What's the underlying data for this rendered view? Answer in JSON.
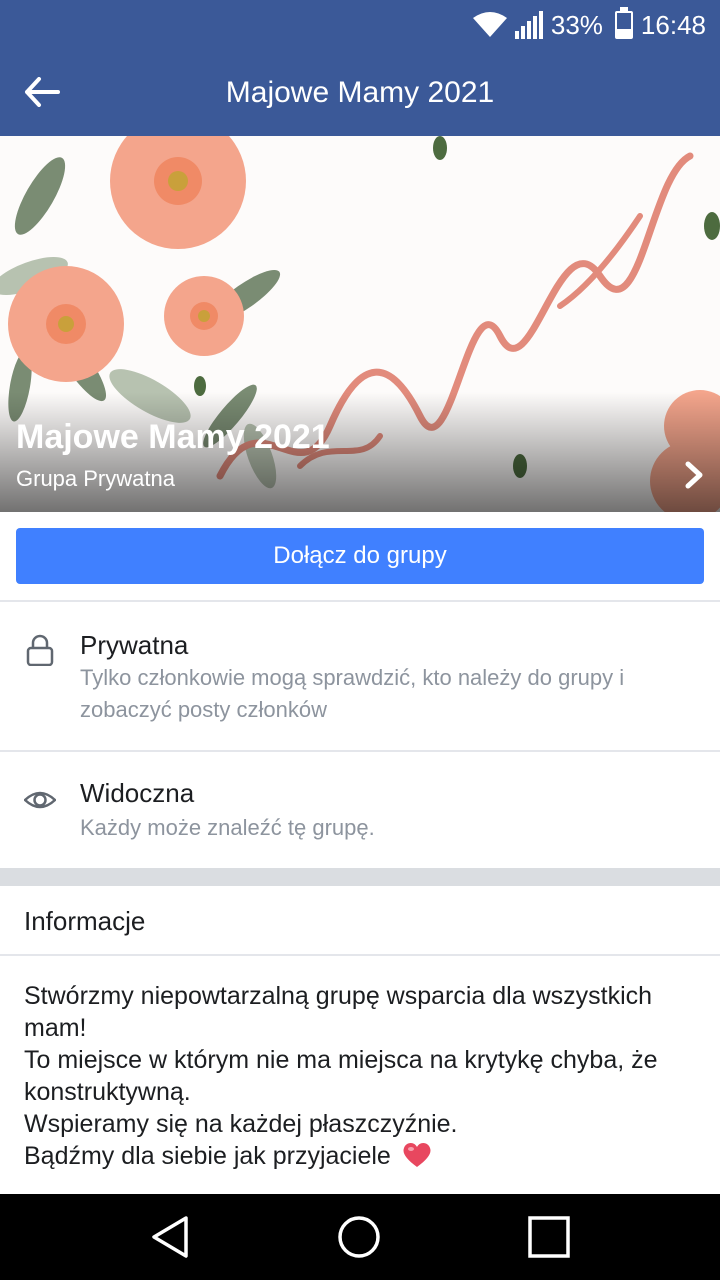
{
  "status_bar": {
    "battery": "33%",
    "time": "16:48",
    "icons": [
      "wifi-icon",
      "signal-icon",
      "battery-icon"
    ]
  },
  "app_bar": {
    "title": "Majowe Mamy 2021",
    "back_icon": "arrow-left-icon"
  },
  "cover": {
    "group_name": "Majowe Mamy 2021",
    "group_type": "Grupa Prywatna",
    "chevron_icon": "chevron-right-icon"
  },
  "join": {
    "label": "Dołącz do grupy",
    "color": "#4080ff"
  },
  "privacy": {
    "icon": "lock-icon",
    "title": "Prywatna",
    "subtitle": "Tylko członkowie mogą sprawdzić, kto należy do grupy i zobaczyć posty członków"
  },
  "visibility": {
    "icon": "eye-icon",
    "title": "Widoczna",
    "subtitle": "Każdy może znaleźć tę grupę."
  },
  "about": {
    "header": "Informacje",
    "lines": [
      "Stwórzmy niepowtarzalną grupę wsparcia dla wszystkich mam!",
      "To miejsce w którym nie ma miejsca na krytykę chyba, że konstruktywną.",
      "Wspieramy się na każdej płaszczyźnie.",
      "Bądźmy dla siebie jak przyjaciele"
    ],
    "emoji_icon": "heart-icon"
  },
  "nav_bar": {
    "icons": [
      "back-triangle-icon",
      "home-circle-icon",
      "recents-square-icon"
    ]
  },
  "colors": {
    "brand": "#3b5998",
    "accent": "#4080ff",
    "secondary_text": "#8d949e"
  }
}
